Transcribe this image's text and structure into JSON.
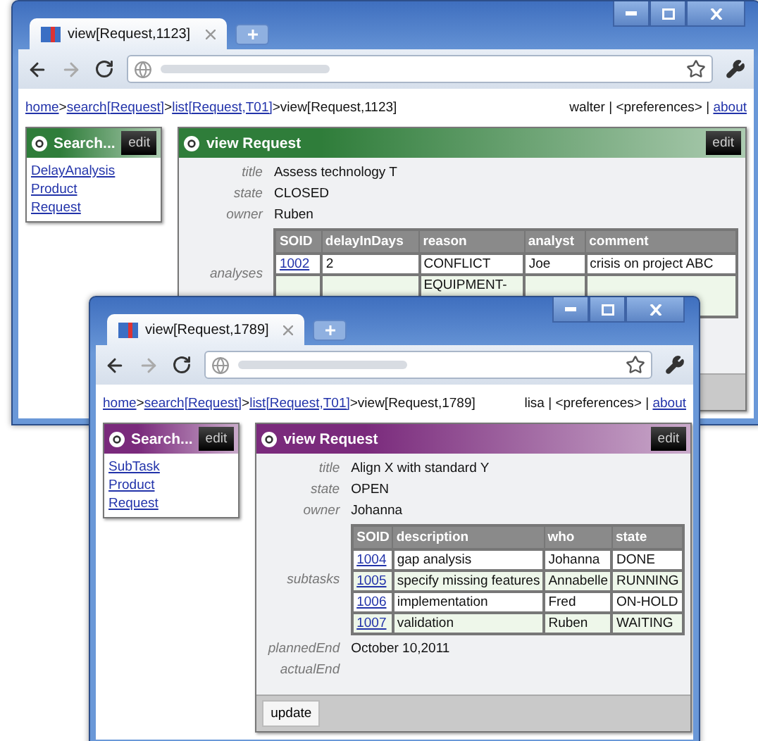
{
  "windows": [
    {
      "tab_title": "view[Request,1123]",
      "color": "#2f7d3a",
      "breadcrumb": [
        {
          "text": "home",
          "link": true
        },
        {
          "text": ">",
          "link": false
        },
        {
          "text": "search[Request]",
          "link": true
        },
        {
          "text": ">",
          "link": false
        },
        {
          "text": "list[Request,T01]",
          "link": true
        },
        {
          "text": ">view[Request,1123]",
          "link": false
        }
      ],
      "user_bar": [
        {
          "text": "walter | <preferences> | ",
          "link": false
        },
        {
          "text": "about",
          "link": true
        }
      ],
      "search_panel": {
        "title": "Search...",
        "edit": "edit",
        "links": [
          "DelayAnalysis",
          "Product",
          "Request"
        ]
      },
      "view_panel": {
        "title": "view Request",
        "edit": "edit",
        "fields": [
          {
            "kind": "text",
            "label": "title",
            "value": "Assess technology T"
          },
          {
            "kind": "text",
            "label": "state",
            "value": "CLOSED"
          },
          {
            "kind": "text",
            "label": "owner",
            "value": "Ruben"
          },
          {
            "kind": "table",
            "label": "analyses",
            "columns": [
              "SOID",
              "delayInDays",
              "reason",
              "analyst",
              "comment"
            ],
            "rows": [
              [
                "1002",
                "2",
                "CONFLICT",
                "Joe",
                "crisis on project ABC"
              ],
              [
                "",
                "",
                "EQUIPMENT-",
                "",
                ""
              ]
            ]
          }
        ]
      }
    },
    {
      "tab_title": "view[Request,1789]",
      "color": "#7a2a7c",
      "breadcrumb": [
        {
          "text": "home",
          "link": true
        },
        {
          "text": ">",
          "link": false
        },
        {
          "text": "search[Request]",
          "link": true
        },
        {
          "text": ">",
          "link": false
        },
        {
          "text": "list[Request,T01]",
          "link": true
        },
        {
          "text": ">view[Request,1789]",
          "link": false
        }
      ],
      "user_bar": [
        {
          "text": "lisa | <preferences> | ",
          "link": false
        },
        {
          "text": "about",
          "link": true
        }
      ],
      "search_panel": {
        "title": "Search...",
        "edit": "edit",
        "links": [
          "SubTask",
          "Product",
          "Request"
        ]
      },
      "view_panel": {
        "title": "view Request",
        "edit": "edit",
        "fields": [
          {
            "kind": "text",
            "label": "title",
            "value": "Align X with standard Y"
          },
          {
            "kind": "text",
            "label": "state",
            "value": "OPEN"
          },
          {
            "kind": "text",
            "label": "owner",
            "value": "Johanna"
          },
          {
            "kind": "table",
            "label": "subtasks",
            "columns": [
              "SOID",
              "description",
              "who",
              "state"
            ],
            "rows": [
              [
                "1004",
                "gap analysis",
                "Johanna",
                "DONE"
              ],
              [
                "1005",
                "specify missing features",
                "Annabelle",
                "RUNNING"
              ],
              [
                "1006",
                "implementation",
                "Fred",
                "ON-HOLD"
              ],
              [
                "1007",
                "validation",
                "Ruben",
                "WAITING"
              ]
            ]
          },
          {
            "kind": "text",
            "label": "plannedEnd",
            "value": "October 10,2011"
          },
          {
            "kind": "text",
            "label": "actualEnd"
          }
        ],
        "footer_button": "update"
      }
    }
  ]
}
